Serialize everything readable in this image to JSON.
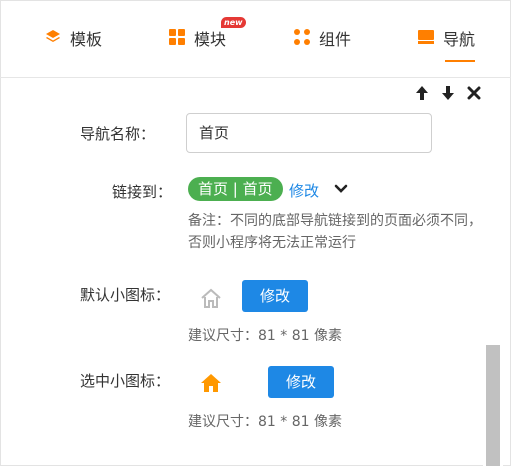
{
  "tabs": [
    {
      "label": "模板",
      "icon": "layers-icon"
    },
    {
      "label": "模块",
      "icon": "grid-icon",
      "badge": "new"
    },
    {
      "label": "组件",
      "icon": "dots-grid-icon"
    },
    {
      "label": "导航",
      "icon": "nav-bar-icon",
      "active": true
    }
  ],
  "toolbar": {
    "up": "up-arrow-icon",
    "down": "down-arrow-icon",
    "close": "close-icon"
  },
  "form": {
    "nav_name_label": "导航名称：",
    "nav_name_value": "首页",
    "link_label": "链接到：",
    "link_value": "首页 | 首页",
    "link_edit": "修改",
    "note": "备注：不同的底部导航链接到的页面必须不同，否则小程序将无法正常运行",
    "default_icon_label": "默认小图标：",
    "default_icon_btn": "修改",
    "default_icon_hint": "建议尺寸：81 * 81 像素",
    "selected_icon_label": "选中小图标：",
    "selected_icon_btn": "修改",
    "selected_icon_hint": "建议尺寸：81 * 81 像素"
  },
  "colors": {
    "accent": "#ff7f00",
    "primary": "#1e88e5",
    "success": "#4caf50",
    "badge": "#e53935"
  }
}
